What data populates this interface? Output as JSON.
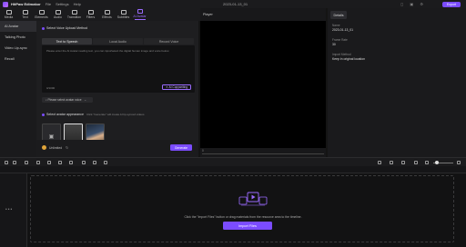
{
  "app": {
    "name": "HitPaw Edimakor",
    "menu": [
      "File",
      "Settings",
      "Help"
    ],
    "project_title": "2023-01-13_01",
    "export_label": "Export"
  },
  "toolbar": {
    "items": [
      {
        "label": "Media",
        "icon": "media-icon"
      },
      {
        "label": "Text",
        "icon": "text-icon"
      },
      {
        "label": "Elements",
        "icon": "elements-icon"
      },
      {
        "label": "Audio",
        "icon": "audio-icon"
      },
      {
        "label": "Transition",
        "icon": "transition-icon"
      },
      {
        "label": "Filters",
        "icon": "filters-icon"
      },
      {
        "label": "Effects",
        "icon": "effects-icon"
      },
      {
        "label": "Subtitles",
        "icon": "subtitles-icon"
      },
      {
        "label": "AI Avatar",
        "icon": "ai-avatar-icon",
        "active": true
      }
    ]
  },
  "sidebar": {
    "items": [
      {
        "label": "AI Avatar",
        "active": true
      },
      {
        "label": "Talking Photo"
      },
      {
        "label": "Video Lip-sync"
      },
      {
        "label": "Recall"
      }
    ]
  },
  "panel": {
    "voice_section_title": "Select Voice Upload Method",
    "tabs": [
      "Text to Speech",
      "Local Audio",
      "Record Voice"
    ],
    "textbox_placeholder": "Please enter the AI Avatar reading text, you can input/select the digital human image and voice below.",
    "char_count": "0/1000",
    "ai_copywriting_label": "AI Copywriting",
    "voice_select_placeholder": "Please select avatar voice",
    "avatar_section_title": "Select avatar appearance",
    "avatar_section_hint": "Click \"Generate\" will create AI lip-synced videos",
    "credits": "Unlimited",
    "generate_label": "Generate"
  },
  "player": {
    "title": "Player",
    "time": "0"
  },
  "details": {
    "tab_label": "Details",
    "fields": [
      {
        "label": "Name",
        "value": "2023-01-13_01"
      },
      {
        "label": "Frame Rate",
        "value": "30"
      },
      {
        "label": "Import Method",
        "value": "Keep in original location"
      }
    ]
  },
  "timeline": {
    "drop_text": "Click the \"Import Files\" button or drag materials from the resource area to the timeline.",
    "import_label": "Import Files"
  },
  "colors": {
    "accent": "#7b4cff",
    "accent_text": "#9b6bff"
  }
}
